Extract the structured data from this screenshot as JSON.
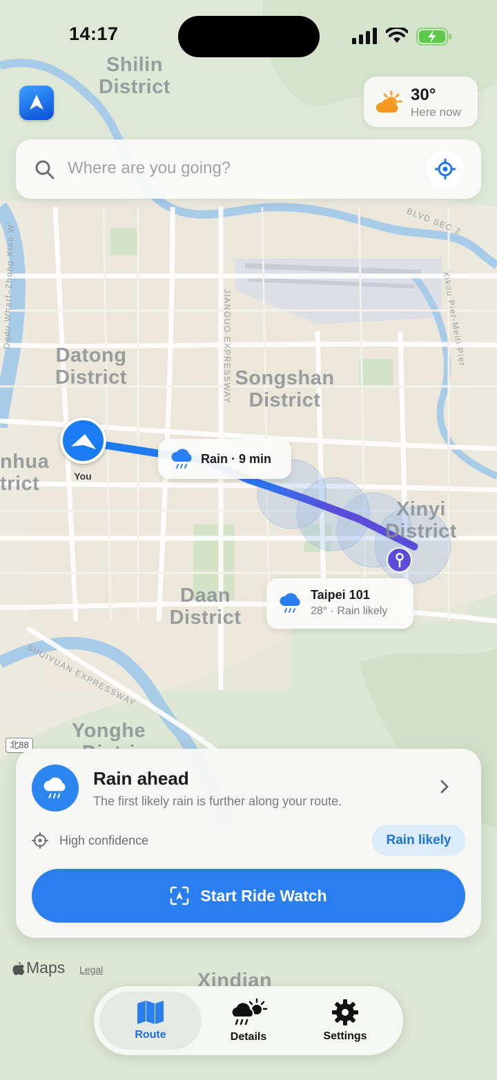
{
  "status_bar": {
    "time": "14:17"
  },
  "weather_chip": {
    "temperature": "30°",
    "caption": "Here now",
    "icon": "sun-behind-cloud-icon"
  },
  "search": {
    "placeholder": "Where are you going?"
  },
  "map": {
    "districts": [
      {
        "key": "shilin",
        "line1": "Shilin",
        "line2": "District"
      },
      {
        "key": "datong",
        "line1": "Datong",
        "line2": "District"
      },
      {
        "key": "songshan",
        "line1": "Songshan",
        "line2": "District"
      },
      {
        "key": "xinyi",
        "line1": "Xinyi",
        "line2": "District"
      },
      {
        "key": "daan",
        "line1": "Daan",
        "line2": "District"
      },
      {
        "key": "wanhua",
        "line1": "nhua",
        "line2": "trict"
      },
      {
        "key": "yonghe",
        "line1": "Yonghe",
        "line2": "Distri"
      },
      {
        "key": "xindian",
        "line1": "Xindian",
        "line2": ""
      }
    ],
    "roads": {
      "jianguo": "JIANGUO EXPRESSWAY",
      "shuiyuan": "SHUIYUAN EXPRESSWAY",
      "bvld": "BLVD SEC 2",
      "xikou": "Xikou Pier-Meiti Pier",
      "dadu": "Dadu Wharf–Zhong Xiao W",
      "shield": "北88"
    },
    "you_label": "You",
    "rain_bubble": "Rain · 9 min",
    "destination": {
      "name": "Taipei 101",
      "detail": "28° · Rain likely"
    }
  },
  "card": {
    "title": "Rain ahead",
    "subtitle": "The first likely rain is further along your route.",
    "confidence": "High confidence",
    "badge": "Rain likely",
    "button": "Start Ride Watch"
  },
  "attribution": {
    "maps": "Maps",
    "legal": "Legal"
  },
  "tabs": [
    {
      "label": "Route",
      "icon": "map-icon",
      "active": true
    },
    {
      "label": "Details",
      "icon": "cloud-sun-rain-icon",
      "active": false
    },
    {
      "label": "Settings",
      "icon": "gear-icon",
      "active": false
    }
  ],
  "colors": {
    "accent": "#2a7ef0",
    "route_start": "#1a7cf2",
    "route_end": "#5b4dd8",
    "badge_bg": "#dcebf9"
  }
}
